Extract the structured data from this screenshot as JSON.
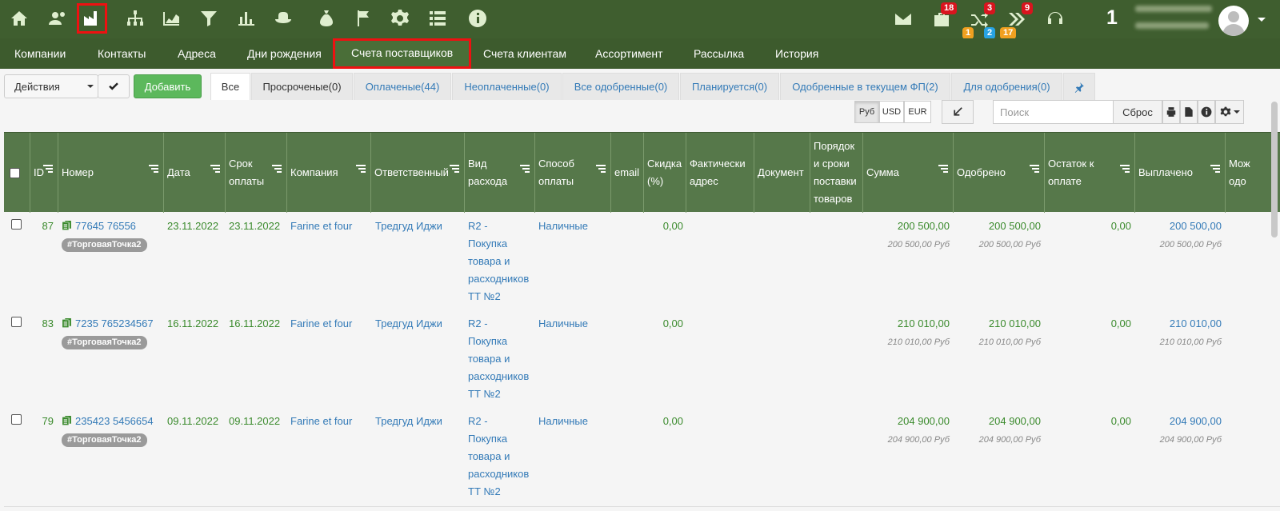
{
  "top_icons": [
    "home-icon",
    "contacts-icon",
    "factory-icon",
    "structure-icon",
    "area-chart-icon",
    "funnel-icon",
    "bar-chart-icon",
    "hat-icon",
    "money-bag-icon",
    "flags-icon",
    "gear-icon",
    "list-icon",
    "info-icon"
  ],
  "notifications": {
    "mail_icon": "envelope-icon",
    "briefcase_badge": "18",
    "shuffle_badge_top": "3",
    "shuffle_badge_a": "1",
    "shuffle_badge_b": "2",
    "forward_badge_top": "9",
    "forward_badge_bottom": "17",
    "counter": "1"
  },
  "nav": {
    "items": [
      "Компании",
      "Контакты",
      "Адреса",
      "Дни рождения",
      "Счета поставщиков",
      "Счета клиентам",
      "Ассортимент",
      "Рассылка",
      "История"
    ],
    "active": "Счета поставщиков"
  },
  "toolbar": {
    "actions_label": "Действия",
    "add_label": "Добавить",
    "tabs": [
      "Все",
      "Просроченые(0)",
      "Оплаченые(44)",
      "Неоплаченные(0)",
      "Все одобренные(0)",
      "Планируется(0)",
      "Одобренные в текущем ФП(2)",
      "Для одобрения(0)"
    ],
    "currencies": [
      "Руб",
      "USD",
      "EUR"
    ],
    "active_currency": "Руб",
    "search_placeholder": "Поиск",
    "reset_label": "Сброс"
  },
  "table": {
    "headers": {
      "id": "ID",
      "number": "Номер",
      "date": "Дата",
      "due_l1": "Срок",
      "due_l2": "оплаты",
      "company": "Компания",
      "responsible": "Ответственный",
      "expense_l1": "Вид",
      "expense_l2": "расхода",
      "payment_l1": "Способ",
      "payment_l2": "оплаты",
      "email": "email",
      "discount_l1": "Скидка",
      "discount_l2": "(%)",
      "address_l1": "Фактически",
      "address_l2": "адрес",
      "document": "Документ",
      "order_l1": "Порядок",
      "order_l2": "и сроки",
      "order_l3": "поставки",
      "order_l4": "товаров",
      "sum": "Сумма",
      "approved": "Одобрено",
      "remaining_l1": "Остаток к",
      "remaining_l2": "оплате",
      "paid": "Выплачено",
      "extra_l1": "Мож",
      "extra_l2": "одо"
    },
    "rows": [
      {
        "id": "87",
        "number": "77645 76556",
        "tag": "#ТорговаяТочка2",
        "date": "23.11.2022",
        "due": "23.11.2022",
        "company": "Farine et four",
        "responsible": "Тредгуд Иджи",
        "expense": [
          "R2 -",
          "Покупка",
          "товара и",
          "расходников",
          "ТТ №2"
        ],
        "payment": "Наличные",
        "discount": "0,00",
        "sum": "200 500,00",
        "sum_sub": "200 500,00 Руб",
        "approved": "200 500,00",
        "approved_sub": "200 500,00 Руб",
        "remaining": "0,00",
        "paid": "200 500,00",
        "paid_sub": "200 500,00 Руб"
      },
      {
        "id": "83",
        "number": "7235 765234567",
        "tag": "#ТорговаяТочка2",
        "date": "16.11.2022",
        "due": "16.11.2022",
        "company": "Farine et four",
        "responsible": "Тредгуд Иджи",
        "expense": [
          "R2 -",
          "Покупка",
          "товара и",
          "расходников",
          "ТТ №2"
        ],
        "payment": "Наличные",
        "discount": "0,00",
        "sum": "210 010,00",
        "sum_sub": "210 010,00 Руб",
        "approved": "210 010,00",
        "approved_sub": "210 010,00 Руб",
        "remaining": "0,00",
        "paid": "210 010,00",
        "paid_sub": "210 010,00 Руб"
      },
      {
        "id": "79",
        "number": "235423 5456654",
        "tag": "#ТорговаяТочка2",
        "date": "09.11.2022",
        "due": "09.11.2022",
        "company": "Farine et four",
        "responsible": "Тредгуд Иджи",
        "expense": [
          "R2 -",
          "Покупка",
          "товара и",
          "расходников",
          "ТТ №2"
        ],
        "payment": "Наличные",
        "discount": "0,00",
        "sum": "204 900,00",
        "sum_sub": "204 900,00 Руб",
        "approved": "204 900,00",
        "approved_sub": "204 900,00 Руб",
        "remaining": "0,00",
        "paid": "204 900,00",
        "paid_sub": "204 900,00 Руб"
      }
    ]
  },
  "colors": {
    "topbar": "#3f5e2f",
    "header": "#56784a",
    "highlight": "#e11111",
    "green_text": "#3a8a2c",
    "link": "#337ab7"
  }
}
